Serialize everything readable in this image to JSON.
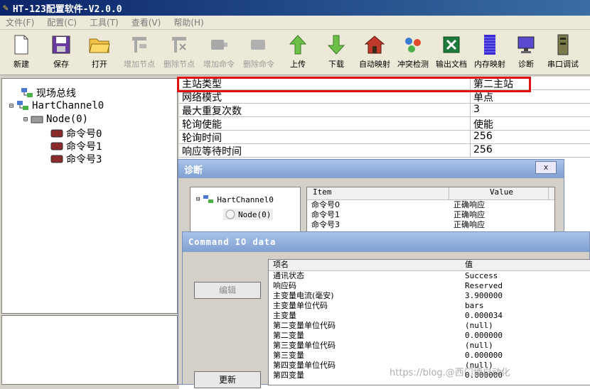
{
  "window": {
    "title": "HT-123配置软件-V2.0.0"
  },
  "menu": [
    "文件(F)",
    "配置(C)",
    "工具(T)",
    "查看(V)",
    "帮助(H)"
  ],
  "toolbar": [
    {
      "label": "新建",
      "icon": "new-file-icon",
      "enabled": true
    },
    {
      "label": "保存",
      "icon": "save-icon",
      "enabled": true
    },
    {
      "label": "打开",
      "icon": "open-folder-icon",
      "enabled": true
    },
    {
      "label": "增加节点",
      "icon": "add-node-icon",
      "enabled": false
    },
    {
      "label": "删除节点",
      "icon": "delete-node-icon",
      "enabled": false
    },
    {
      "label": "增加命令",
      "icon": "add-command-icon",
      "enabled": false
    },
    {
      "label": "删除命令",
      "icon": "delete-command-icon",
      "enabled": false
    },
    {
      "label": "上传",
      "icon": "upload-arrow-icon",
      "enabled": true
    },
    {
      "label": "下载",
      "icon": "download-arrow-icon",
      "enabled": true
    },
    {
      "label": "自动映射",
      "icon": "house-icon",
      "enabled": true
    },
    {
      "label": "冲突检测",
      "icon": "conflict-check-icon",
      "enabled": true
    },
    {
      "label": "输出文档",
      "icon": "excel-icon",
      "enabled": true
    },
    {
      "label": "内存映射",
      "icon": "memory-icon",
      "enabled": true
    },
    {
      "label": "诊断",
      "icon": "monitor-icon",
      "enabled": true
    },
    {
      "label": "串口调试",
      "icon": "serial-icon",
      "enabled": true
    }
  ],
  "tree": {
    "root": "现场总线",
    "channel": "HartChannel0",
    "node": "Node(0)",
    "commands": [
      "命令号0",
      "命令号1",
      "命令号3"
    ]
  },
  "properties": [
    {
      "key": "主站类型",
      "value": "第二主站"
    },
    {
      "key": "网络模式",
      "value": "单点"
    },
    {
      "key": "最大重复次数",
      "value": "3"
    },
    {
      "key": "轮询使能",
      "value": "使能"
    },
    {
      "key": "轮询时间",
      "value": "256"
    },
    {
      "key": "响应等待时间",
      "value": "256"
    }
  ],
  "diagnose": {
    "title": "诊断",
    "close": "x",
    "tree_channel": "HartChannel0",
    "tree_node": "Node(0)",
    "col_item": "Item",
    "col_value": "Value",
    "rows": [
      {
        "item": "命令号0",
        "value": "正确响应"
      },
      {
        "item": "命令号1",
        "value": "正确响应"
      },
      {
        "item": "命令号3",
        "value": "正确响应"
      }
    ]
  },
  "command_io": {
    "title": "Command IO data",
    "edit_button": "编辑",
    "update_button": "更新",
    "col_name": "项名",
    "col_value": "值",
    "rows": [
      {
        "name": "通讯状态",
        "value": "Success"
      },
      {
        "name": "响应码",
        "value": "Reserved"
      },
      {
        "name": "主变量电流(毫安)",
        "value": "3.900000"
      },
      {
        "name": "主变量单位代码",
        "value": "bars"
      },
      {
        "name": "主变量",
        "value": "0.000034"
      },
      {
        "name": "第二变量单位代码",
        "value": "(null)"
      },
      {
        "name": "第二变量",
        "value": "0.000000"
      },
      {
        "name": "第三变量单位代码",
        "value": "(null)"
      },
      {
        "name": "第三变量",
        "value": "0.000000"
      },
      {
        "name": "第四变量单位代码",
        "value": "(null)"
      },
      {
        "name": "第四变量",
        "value": "0.000000"
      }
    ]
  },
  "watermark": "https://blog.@西门博自动化"
}
